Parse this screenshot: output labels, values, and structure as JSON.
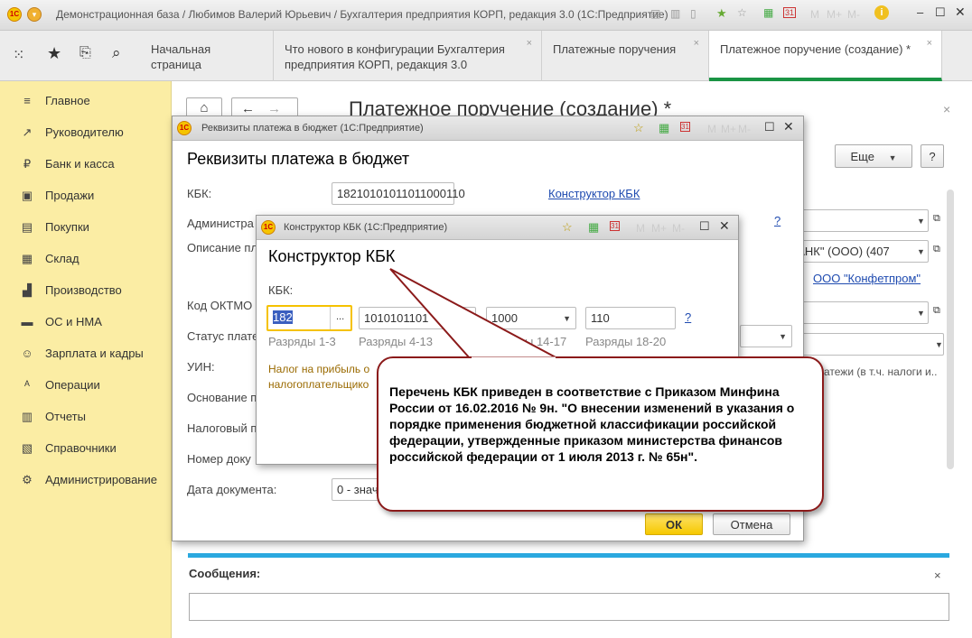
{
  "window": {
    "title": "Демонстрационная база / Любимов Валерий Юрьевич / Бухгалтерия предприятия КОРП, редакция 3.0  (1С:Предприятие)",
    "logo": "1С",
    "m": "M",
    "mplus": "M+",
    "mminus": "M-",
    "calendar": "31"
  },
  "tabs": [
    {
      "label": "Начальная страница"
    },
    {
      "label": "Что нового в конфигурации Бухгалтерия предприятия КОРП, редакция 3.0"
    },
    {
      "label": "Платежные поручения"
    },
    {
      "label": "Платежное поручение (создание) *"
    }
  ],
  "close_x": "×",
  "sidebar": {
    "items": [
      {
        "label": "Главное",
        "icon": "≡"
      },
      {
        "label": "Руководителю",
        "icon": "↗"
      },
      {
        "label": "Банк и касса",
        "icon": "₽"
      },
      {
        "label": "Продажи",
        "icon": "▣"
      },
      {
        "label": "Покупки",
        "icon": "▤"
      },
      {
        "label": "Склад",
        "icon": "▦"
      },
      {
        "label": "Производство",
        "icon": "▟"
      },
      {
        "label": "ОС и НМА",
        "icon": "▬"
      },
      {
        "label": "Зарплата и кадры",
        "icon": "☺"
      },
      {
        "label": "Операции",
        "icon": "ᴬ"
      },
      {
        "label": "Отчеты",
        "icon": "▥"
      },
      {
        "label": "Справочники",
        "icon": "▧"
      },
      {
        "label": "Администрирование",
        "icon": "⚙"
      }
    ]
  },
  "main": {
    "title": "Платежное поручение (создание) *",
    "more_label": "Еще",
    "help_label": "?",
    "bank_value": "БАНК\" (ООО) (407",
    "org_link": "ООО \"Конфетпром\"",
    "payments_text": "атежи (в т.ч. налоги и..",
    "messages_label": "Сообщения:"
  },
  "budget_dialog": {
    "window_title": "Реквизиты платежа в бюджет  (1С:Предприятие)",
    "heading": "Реквизиты платежа в бюджет",
    "kbk_label": "КБК:",
    "kbk_value": "18210101011011000110",
    "kbk_link": "Конструктор КБК",
    "admin_label": "Администра",
    "desc_label": "Описание пл",
    "oktmo_label": "Код ОКТМО",
    "status_label": "Статус плате",
    "uin_label": "УИН:",
    "basis_label": "Основание п",
    "period_label": "Налоговый п",
    "docnum_label": "Номер доку",
    "docdate_label": "Дата документа:",
    "docdate_value": "0 - знач",
    "help": "?",
    "ok_label": "ОК",
    "cancel_label": "Отмена"
  },
  "kbk_dialog": {
    "window_title": "Конструктор КБК  (1С:Предприятие)",
    "heading": "Конструктор КБК",
    "kbk_label": "КБК:",
    "parts": [
      {
        "value": "182",
        "caption": "Разряды 1-3"
      },
      {
        "value": "1010101101",
        "caption": "Разряды 4-13"
      },
      {
        "value": "1000",
        "caption": "Разряды 14-17"
      },
      {
        "value": "110",
        "caption": "Разряды 18-20"
      }
    ],
    "ellipsis": "...",
    "help": "?",
    "description": "Налог на прибыль о налогоплательщико"
  },
  "callout": {
    "text": "Перечень КБК приведен в соответствие с Приказом Минфина России от 16.02.2016 № 9н. \"О внесении изменений в указания о порядке применения бюджетной классификации российской федерации, утвержденные приказом министерства финансов российской федерации от 1 июля 2013 г. № 65н\"."
  }
}
